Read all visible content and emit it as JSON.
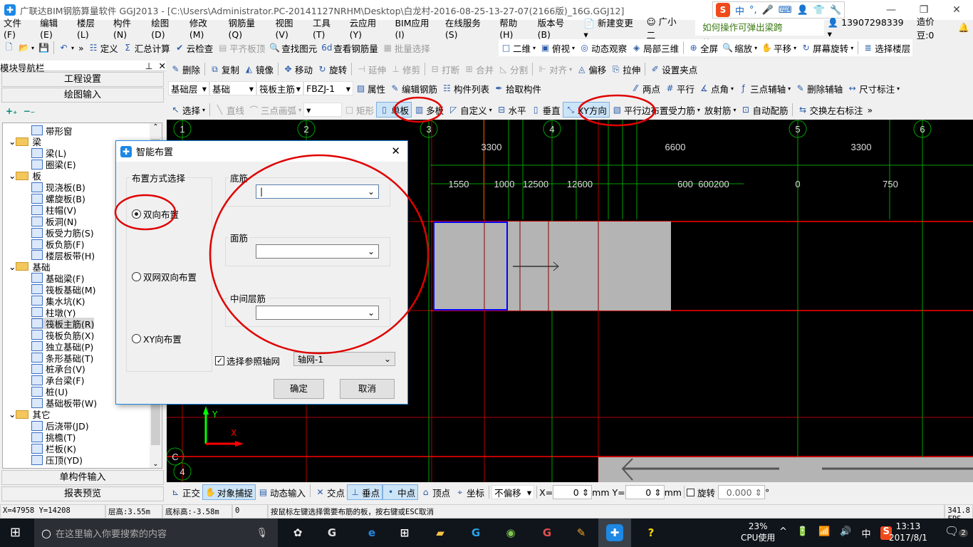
{
  "window": {
    "title": "广联达BIM钢筋算量软件 GGJ2013 - [C:\\Users\\Administrator.PC-20141127NRHM\\Desktop\\白龙村-2016-08-25-13-27-07(2166版)_16G.GGJ12]",
    "minimize": "—",
    "restore": "❐",
    "close": "✕"
  },
  "ime": {
    "logo": "S",
    "items": [
      "中",
      "°,",
      "🎤",
      "⌨",
      "👤",
      "👕",
      "🔧"
    ]
  },
  "menu": [
    "文件(F)",
    "编辑(E)",
    "楼层(L)",
    "构件(N)",
    "绘图(D)",
    "修改(M)",
    "钢筋量(Q)",
    "视图(V)",
    "工具(T)",
    "云应用(Y)",
    "BIM应用(I)",
    "在线服务(S)",
    "帮助(H)",
    "版本号(B)"
  ],
  "menu_right": {
    "new_change": "新建变更",
    "assistant": "广小二",
    "tip": "如何操作可弹出梁跨校..",
    "phone": "13907298339",
    "beans": "造价豆:0"
  },
  "colors": {
    "accent": "#1e88e5",
    "grid_green": "#00a000",
    "grid_red": "#ff0000"
  },
  "toolbar1": [
    {
      "label": "",
      "icon": "🗋"
    },
    {
      "label": "",
      "icon": "📂",
      "dd": true
    },
    {
      "label": "",
      "icon": "💾"
    },
    {
      "sep": true
    },
    {
      "label": "",
      "icon": "↶",
      "dd": true
    },
    {
      "label": "»",
      "icon": ""
    },
    {
      "label": "定义",
      "icon": "☷"
    },
    {
      "label": "汇总计算",
      "icon": "Σ"
    },
    {
      "label": "云检查",
      "icon": "✔"
    },
    {
      "label": "平齐板顶",
      "icon": "▤",
      "dis": true
    },
    {
      "label": "查找图元",
      "icon": "🔍"
    },
    {
      "label": "查看钢筋量",
      "icon": "6d"
    },
    {
      "label": "批量选择",
      "icon": "▦",
      "dis": true
    }
  ],
  "toolbar1b": [
    {
      "label": "二维",
      "icon": "□",
      "dd": true
    },
    {
      "label": "俯视",
      "icon": "▣",
      "dd": true
    },
    {
      "label": "动态观察",
      "icon": "◎"
    },
    {
      "label": "局部三维",
      "icon": "◈"
    },
    {
      "sep": true
    },
    {
      "label": "全屏",
      "icon": "⊕"
    },
    {
      "label": "缩放",
      "icon": "🔍",
      "dd": true
    },
    {
      "label": "平移",
      "icon": "✋",
      "dd": true
    },
    {
      "label": "屏幕旋转",
      "icon": "↻",
      "dd": true
    },
    {
      "sep": true
    },
    {
      "label": "选择楼层",
      "icon": "≣"
    }
  ],
  "toolbar2": [
    {
      "label": "删除",
      "icon": "✎"
    },
    {
      "sep": true
    },
    {
      "label": "复制",
      "icon": "⧉"
    },
    {
      "label": "镜像",
      "icon": "◭"
    },
    {
      "sep": true
    },
    {
      "label": "移动",
      "icon": "✥"
    },
    {
      "label": "旋转",
      "icon": "↻"
    },
    {
      "sep": true
    },
    {
      "label": "延伸",
      "icon": "⊣",
      "dis": true
    },
    {
      "label": "修剪",
      "icon": "⊥",
      "dis": true
    },
    {
      "sep": true
    },
    {
      "label": "打断",
      "icon": "⊟",
      "dis": true
    },
    {
      "label": "合并",
      "icon": "⊞",
      "dis": true
    },
    {
      "label": "分割",
      "icon": "◺",
      "dis": true
    },
    {
      "sep": true
    },
    {
      "label": "对齐",
      "icon": "⊩",
      "dis": true,
      "dd": true
    },
    {
      "label": "偏移",
      "icon": "◬"
    },
    {
      "label": "拉伸",
      "icon": "⎘"
    },
    {
      "sep": true
    },
    {
      "label": "设置夹点",
      "icon": "✐"
    }
  ],
  "toolbar3": {
    "floor": "基础层",
    "category": "基础",
    "component_type": "筏板主筋",
    "component": "FBZJ-1",
    "items": [
      {
        "label": "属性",
        "icon": "▨"
      },
      {
        "label": "编辑钢筋",
        "icon": "✎"
      },
      {
        "label": "构件列表",
        "icon": "☷"
      },
      {
        "label": "拾取构件",
        "icon": "✒"
      }
    ]
  },
  "toolbar3b": [
    {
      "label": "两点",
      "icon": "⁄⁄"
    },
    {
      "label": "平行",
      "icon": "#"
    },
    {
      "label": "点角",
      "icon": "∡",
      "dd": true
    },
    {
      "label": "三点辅轴",
      "icon": "ƒ",
      "dd": true
    },
    {
      "label": "删除辅轴",
      "icon": "✎"
    },
    {
      "label": "尺寸标注",
      "icon": "↔",
      "dd": true
    }
  ],
  "toolbar4": [
    {
      "label": "选择",
      "icon": "↖",
      "dd": true
    },
    {
      "sep": true
    },
    {
      "label": "直线",
      "icon": "╲",
      "dis": true
    },
    {
      "label": "三点画弧",
      "icon": "⌒",
      "dis": true,
      "dd": true
    },
    {
      "combo": true
    },
    {
      "label": "矩形",
      "icon": "□",
      "dis": true
    },
    {
      "label": "单板",
      "icon": "▯",
      "act": true
    },
    {
      "label": "多板",
      "icon": "▥"
    },
    {
      "label": "自定义",
      "icon": "◸",
      "dd": true
    },
    {
      "label": "水平",
      "icon": "⊟"
    },
    {
      "label": "垂直",
      "icon": "▯"
    },
    {
      "label": "XY方向",
      "icon": "⤡",
      "act": true
    },
    {
      "label": "平行边布置受力筋",
      "icon": "▧",
      "dd": true
    },
    {
      "label": "放射筋",
      "icon": "",
      "dd": true
    },
    {
      "label": "自动配筋",
      "icon": "⊡"
    },
    {
      "sep": true
    },
    {
      "label": "交换左右标注",
      "icon": "⇆"
    },
    {
      "label": "»",
      "icon": ""
    }
  ],
  "nav": {
    "title": "模块导航栏",
    "pin": "⊥",
    "close": "✕",
    "project_settings": "工程设置",
    "drawing_input": "绘图输入",
    "expand": "+₊",
    "collapse": "−₋",
    "single_input": "单构件输入",
    "report_preview": "报表预览",
    "tree": [
      {
        "label": "带形窗",
        "lv": 2
      },
      {
        "label": "梁",
        "lv": 1,
        "folder": true
      },
      {
        "label": "梁(L)",
        "lv": 2
      },
      {
        "label": "圈梁(E)",
        "lv": 2
      },
      {
        "label": "板",
        "lv": 1,
        "folder": true
      },
      {
        "label": "现浇板(B)",
        "lv": 2
      },
      {
        "label": "螺旋板(B)",
        "lv": 2
      },
      {
        "label": "柱帽(V)",
        "lv": 2
      },
      {
        "label": "板洞(N)",
        "lv": 2
      },
      {
        "label": "板受力筋(S)",
        "lv": 2
      },
      {
        "label": "板负筋(F)",
        "lv": 2
      },
      {
        "label": "楼层板带(H)",
        "lv": 2
      },
      {
        "label": "基础",
        "lv": 1,
        "folder": true
      },
      {
        "label": "基础梁(F)",
        "lv": 2
      },
      {
        "label": "筏板基础(M)",
        "lv": 2
      },
      {
        "label": "集水坑(K)",
        "lv": 2
      },
      {
        "label": "柱墩(Y)",
        "lv": 2
      },
      {
        "label": "筏板主筋(R)",
        "lv": 2,
        "selected": true
      },
      {
        "label": "筏板负筋(X)",
        "lv": 2
      },
      {
        "label": "独立基础(P)",
        "lv": 2
      },
      {
        "label": "条形基础(T)",
        "lv": 2
      },
      {
        "label": "桩承台(V)",
        "lv": 2
      },
      {
        "label": "承台梁(F)",
        "lv": 2
      },
      {
        "label": "桩(U)",
        "lv": 2
      },
      {
        "label": "基础板带(W)",
        "lv": 2
      },
      {
        "label": "其它",
        "lv": 1,
        "folder": true
      },
      {
        "label": "后浇带(JD)",
        "lv": 2
      },
      {
        "label": "挑檐(T)",
        "lv": 2
      },
      {
        "label": "栏板(K)",
        "lv": 2
      },
      {
        "label": "压顶(YD)",
        "lv": 2
      }
    ]
  },
  "canvas": {
    "axes_top": [
      "1",
      "2",
      "3",
      "4",
      "5",
      "6"
    ],
    "axes_left": [
      "C",
      "4"
    ],
    "dims_top": [
      "3300",
      "6600",
      "3300"
    ],
    "dims_second": [
      "1550",
      "1000",
      "12500",
      "12600",
      "600",
      "600200",
      "0",
      "750"
    ],
    "x_label": "X",
    "y_label": "Y"
  },
  "dialog": {
    "title": "智能布置",
    "close": "✕",
    "mode_group": "布置方式选择",
    "modes": [
      {
        "label": "双向布置",
        "checked": true
      },
      {
        "label": "双网双向布置",
        "checked": false
      },
      {
        "label": "XY向布置",
        "checked": false
      }
    ],
    "bottom_bar": "底筋",
    "bottom_bar_value": "",
    "top_bar": "面筋",
    "top_bar_value": "",
    "mid_bar": "中间层筋",
    "mid_bar_value": "",
    "ref_grid_checkbox": "选择参照轴网",
    "ref_grid_checked": true,
    "ref_grid_value": "轴网-1",
    "ok": "确定",
    "cancel": "取消"
  },
  "bottombar": {
    "items": [
      {
        "label": "正交",
        "icon": "⊾"
      },
      {
        "label": "对象捕捉",
        "icon": "✋",
        "act": true
      },
      {
        "label": "动态输入",
        "icon": "▤"
      },
      {
        "sep": true
      },
      {
        "label": "交点",
        "icon": "✕"
      },
      {
        "label": "垂点",
        "icon": "⊥",
        "act": true
      },
      {
        "label": "中点",
        "icon": "•",
        "act": true
      },
      {
        "label": "顶点",
        "icon": "⌂"
      },
      {
        "label": "坐标",
        "icon": "⌖"
      }
    ],
    "offset": "不偏移",
    "x_label": "X=",
    "x_value": "0",
    "y_label": "Y=",
    "y_value": "0",
    "unit": "mm",
    "rotate_label": "旋转",
    "rotate_value": "0.000",
    "degree": "°"
  },
  "status": [
    "X=47958 Y=14208",
    "层高:3.55m",
    "底标高:-3.58m",
    "0",
    "按鼠标左键选择需要布筋的板，按右键或ESC取消",
    "341.8 FPS"
  ],
  "taskbar": {
    "search_placeholder": "在这里输入你要搜索的内容",
    "cpu": "23%",
    "cpu_label": "CPU使用",
    "tray": [
      "^",
      "🔋",
      "📶",
      "🔊",
      "中",
      "S"
    ],
    "time": "13:13",
    "date": "2017/8/1",
    "notifications": "2"
  }
}
